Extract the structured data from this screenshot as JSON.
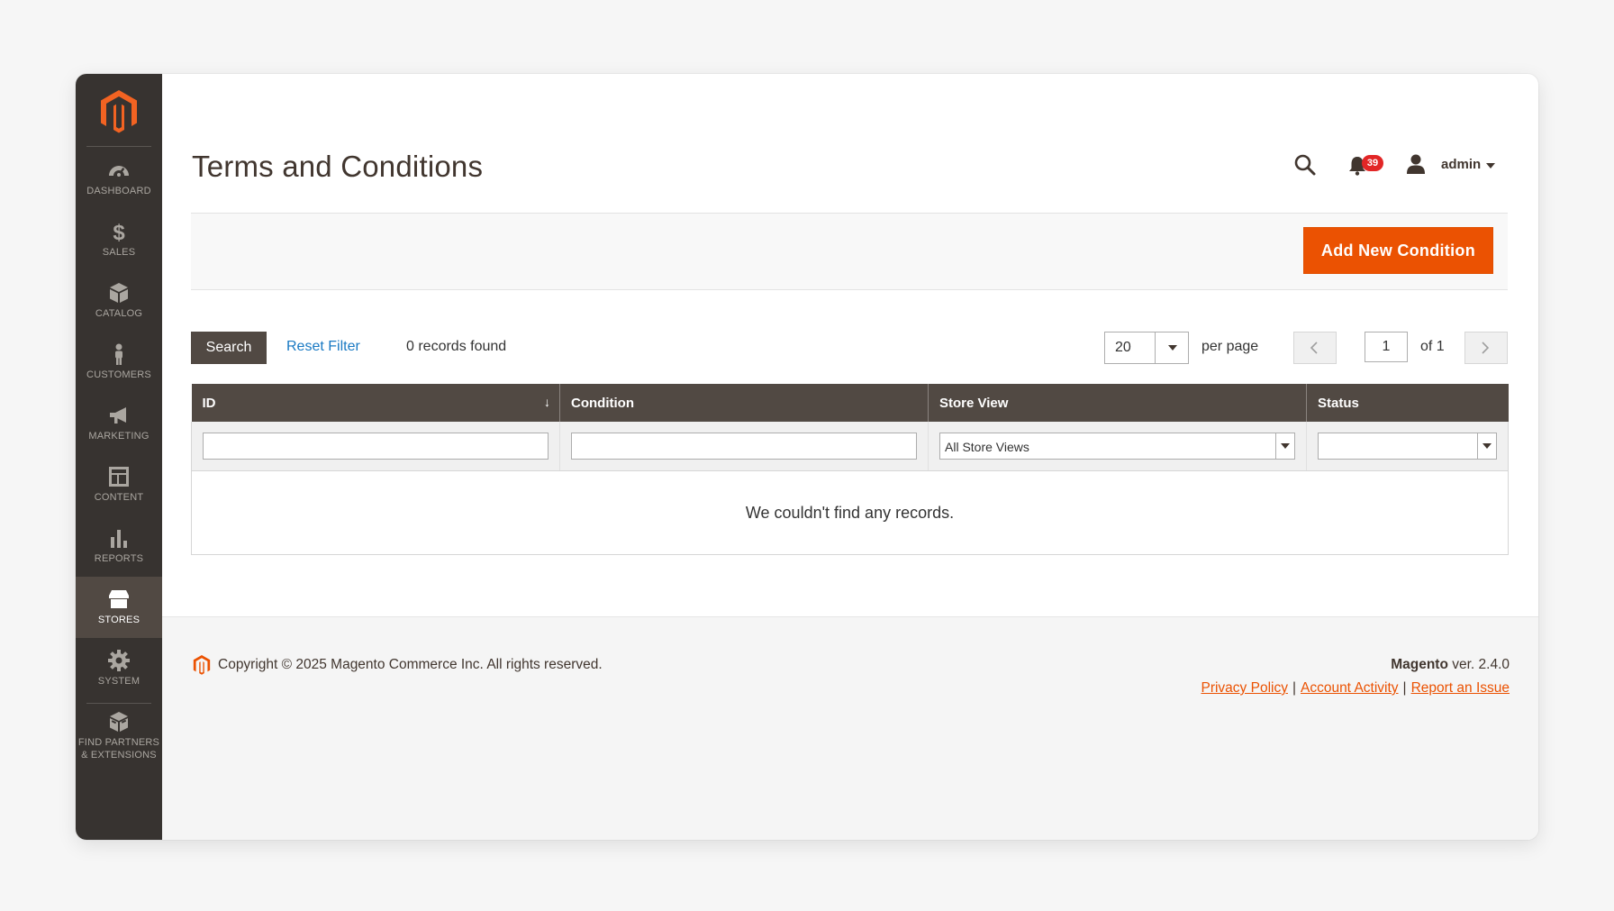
{
  "page": {
    "title": "Terms and Conditions"
  },
  "sidebar": {
    "items": [
      {
        "label": "DASHBOARD",
        "icon": "dashboard-icon"
      },
      {
        "label": "SALES",
        "icon": "dollar-icon"
      },
      {
        "label": "CATALOG",
        "icon": "box-icon"
      },
      {
        "label": "CUSTOMERS",
        "icon": "person-icon"
      },
      {
        "label": "MARKETING",
        "icon": "megaphone-icon"
      },
      {
        "label": "CONTENT",
        "icon": "layout-icon"
      },
      {
        "label": "REPORTS",
        "icon": "bar-chart-icon"
      },
      {
        "label": "STORES",
        "icon": "storefront-icon",
        "active": true
      },
      {
        "label": "SYSTEM",
        "icon": "gear-icon"
      },
      {
        "label": "FIND PARTNERS",
        "label2": "& EXTENSIONS",
        "icon": "partners-box-icon"
      }
    ]
  },
  "header": {
    "notifications_count": "39",
    "user": "admin"
  },
  "actions": {
    "add_new": "Add New Condition"
  },
  "toolbar": {
    "search": "Search",
    "reset_filter": "Reset Filter",
    "records_found": "0 records found",
    "per_page_value": "20",
    "per_page_label": "per page",
    "current_page": "1",
    "page_of": "of 1"
  },
  "grid": {
    "columns": [
      "ID",
      "Condition",
      "Store View",
      "Status"
    ],
    "sort_indicator": "↓",
    "filters": {
      "store_view": "All Store Views",
      "status": ""
    },
    "empty_message": "We couldn't find any records."
  },
  "footer": {
    "copyright": "Copyright © 2025 Magento Commerce Inc. All rights reserved.",
    "brand": "Magento",
    "version": " ver. 2.4.0",
    "links": [
      "Privacy Policy",
      "Account Activity",
      "Report an Issue"
    ],
    "separator": "|"
  },
  "colors": {
    "accent": "#eb5202",
    "sidebar_bg": "#373330",
    "header_bg": "#514943",
    "link": "#1979c3"
  }
}
